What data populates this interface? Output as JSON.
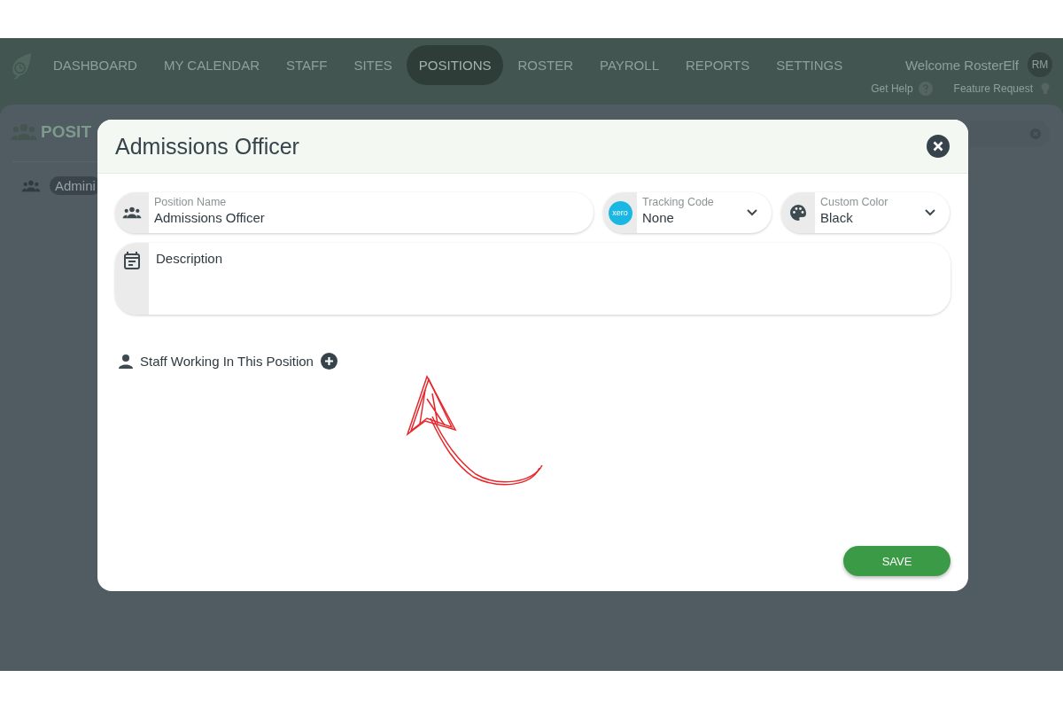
{
  "nav": {
    "items": [
      {
        "label": "DASHBOARD",
        "selected": false
      },
      {
        "label": "MY CALENDAR",
        "selected": false
      },
      {
        "label": "STAFF",
        "selected": false
      },
      {
        "label": "SITES",
        "selected": false
      },
      {
        "label": "POSITIONS",
        "selected": true
      },
      {
        "label": "ROSTER",
        "selected": false
      },
      {
        "label": "PAYROLL",
        "selected": false
      },
      {
        "label": "REPORTS",
        "selected": false
      },
      {
        "label": "SETTINGS",
        "selected": false
      }
    ],
    "welcome": "Welcome RosterElf",
    "avatar": "RM",
    "help": "Get Help",
    "feature": "Feature Request"
  },
  "page": {
    "heading": "POSIT",
    "chip": "Admini"
  },
  "modal": {
    "title": "Admissions Officer",
    "position_name": {
      "label": "Position Name",
      "value": "Admissions Officer"
    },
    "tracking_code": {
      "label": "Tracking Code",
      "value": "None",
      "logo_text": "xero"
    },
    "custom_color": {
      "label": "Custom Color",
      "value": "Black"
    },
    "description": {
      "placeholder": "Description"
    },
    "staff_label": "Staff Working In This Position",
    "save": "SAVE"
  }
}
